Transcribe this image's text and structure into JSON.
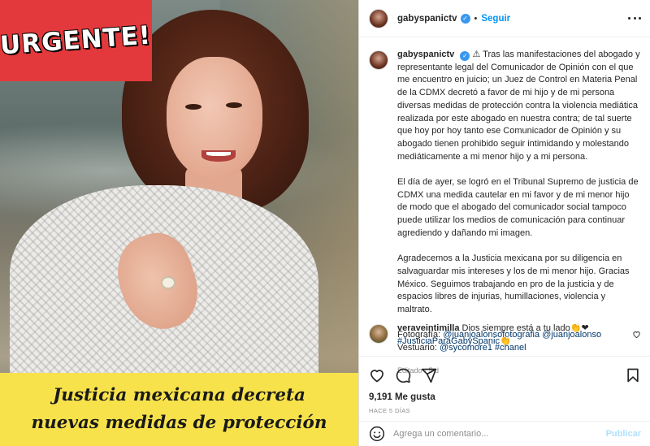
{
  "post_image": {
    "banner_text": "URGENTE!",
    "headline_lines": [
      "Justicia mexicana decreta",
      "nuevas medidas de protección"
    ],
    "colors": {
      "banner": "#e4393c",
      "headline_bg": "#f7e24b"
    }
  },
  "header": {
    "username": "gabyspanictv",
    "separator": "•",
    "follow_label": "Seguir"
  },
  "caption": {
    "username": "gabyspanictv",
    "paragraphs": [
      "⚠ Tras las manifestaciones del abogado y representante legal del Comunicador de Opinión con el que me encuentro en juicio; un Juez de Control en Materia Penal de la CDMX decretó a favor de mi hijo y de mi persona diversas medidas de protección contra la violencia mediática realizada por este abogado en nuestra contra; de tal suerte que hoy por hoy tanto ese Comunicador de Opinión y su abogado tienen prohibido seguir intimidando y molestando mediáticamente a mi menor hijo y a mi persona.",
      "El día de ayer, se logró en el Tribunal Supremo de justicia de CDMX una medida cautelar en mi favor y de mi menor hijo de modo que el abogado del comunicador social tampoco puede utilizar los medios de comunicación para continuar agrediendo y dañando mi imagen.",
      "Agradecemos a la Justicia mexicana por su diligencia en salvaguardar mis intereses y los de mi menor hijo. Gracias México. Seguimos trabajando en pro de la justicia y de espacios libres de injurias, humillaciones, violencia y maltrato."
    ],
    "photo_label": "Fotografía:",
    "photo_links": [
      "@juanjoalonsofotografia",
      "@juanjoalonso"
    ],
    "wardrobe_label": "Vestuario:",
    "wardrobe_links": [
      "@sycomore1",
      "#chanel"
    ],
    "meta": "Editado · 5 d"
  },
  "comment": {
    "username": "veraveintimilla",
    "text": "Dios siempre está a tu lado👏❤",
    "hashtag": "#JusticiaParaGabySpanic👏"
  },
  "actions": {
    "likes": "9,191 Me gusta",
    "time_ago": "HACE 5 DÍAS"
  },
  "comment_box": {
    "placeholder": "Agrega un comentario...",
    "publish_label": "Publicar"
  }
}
